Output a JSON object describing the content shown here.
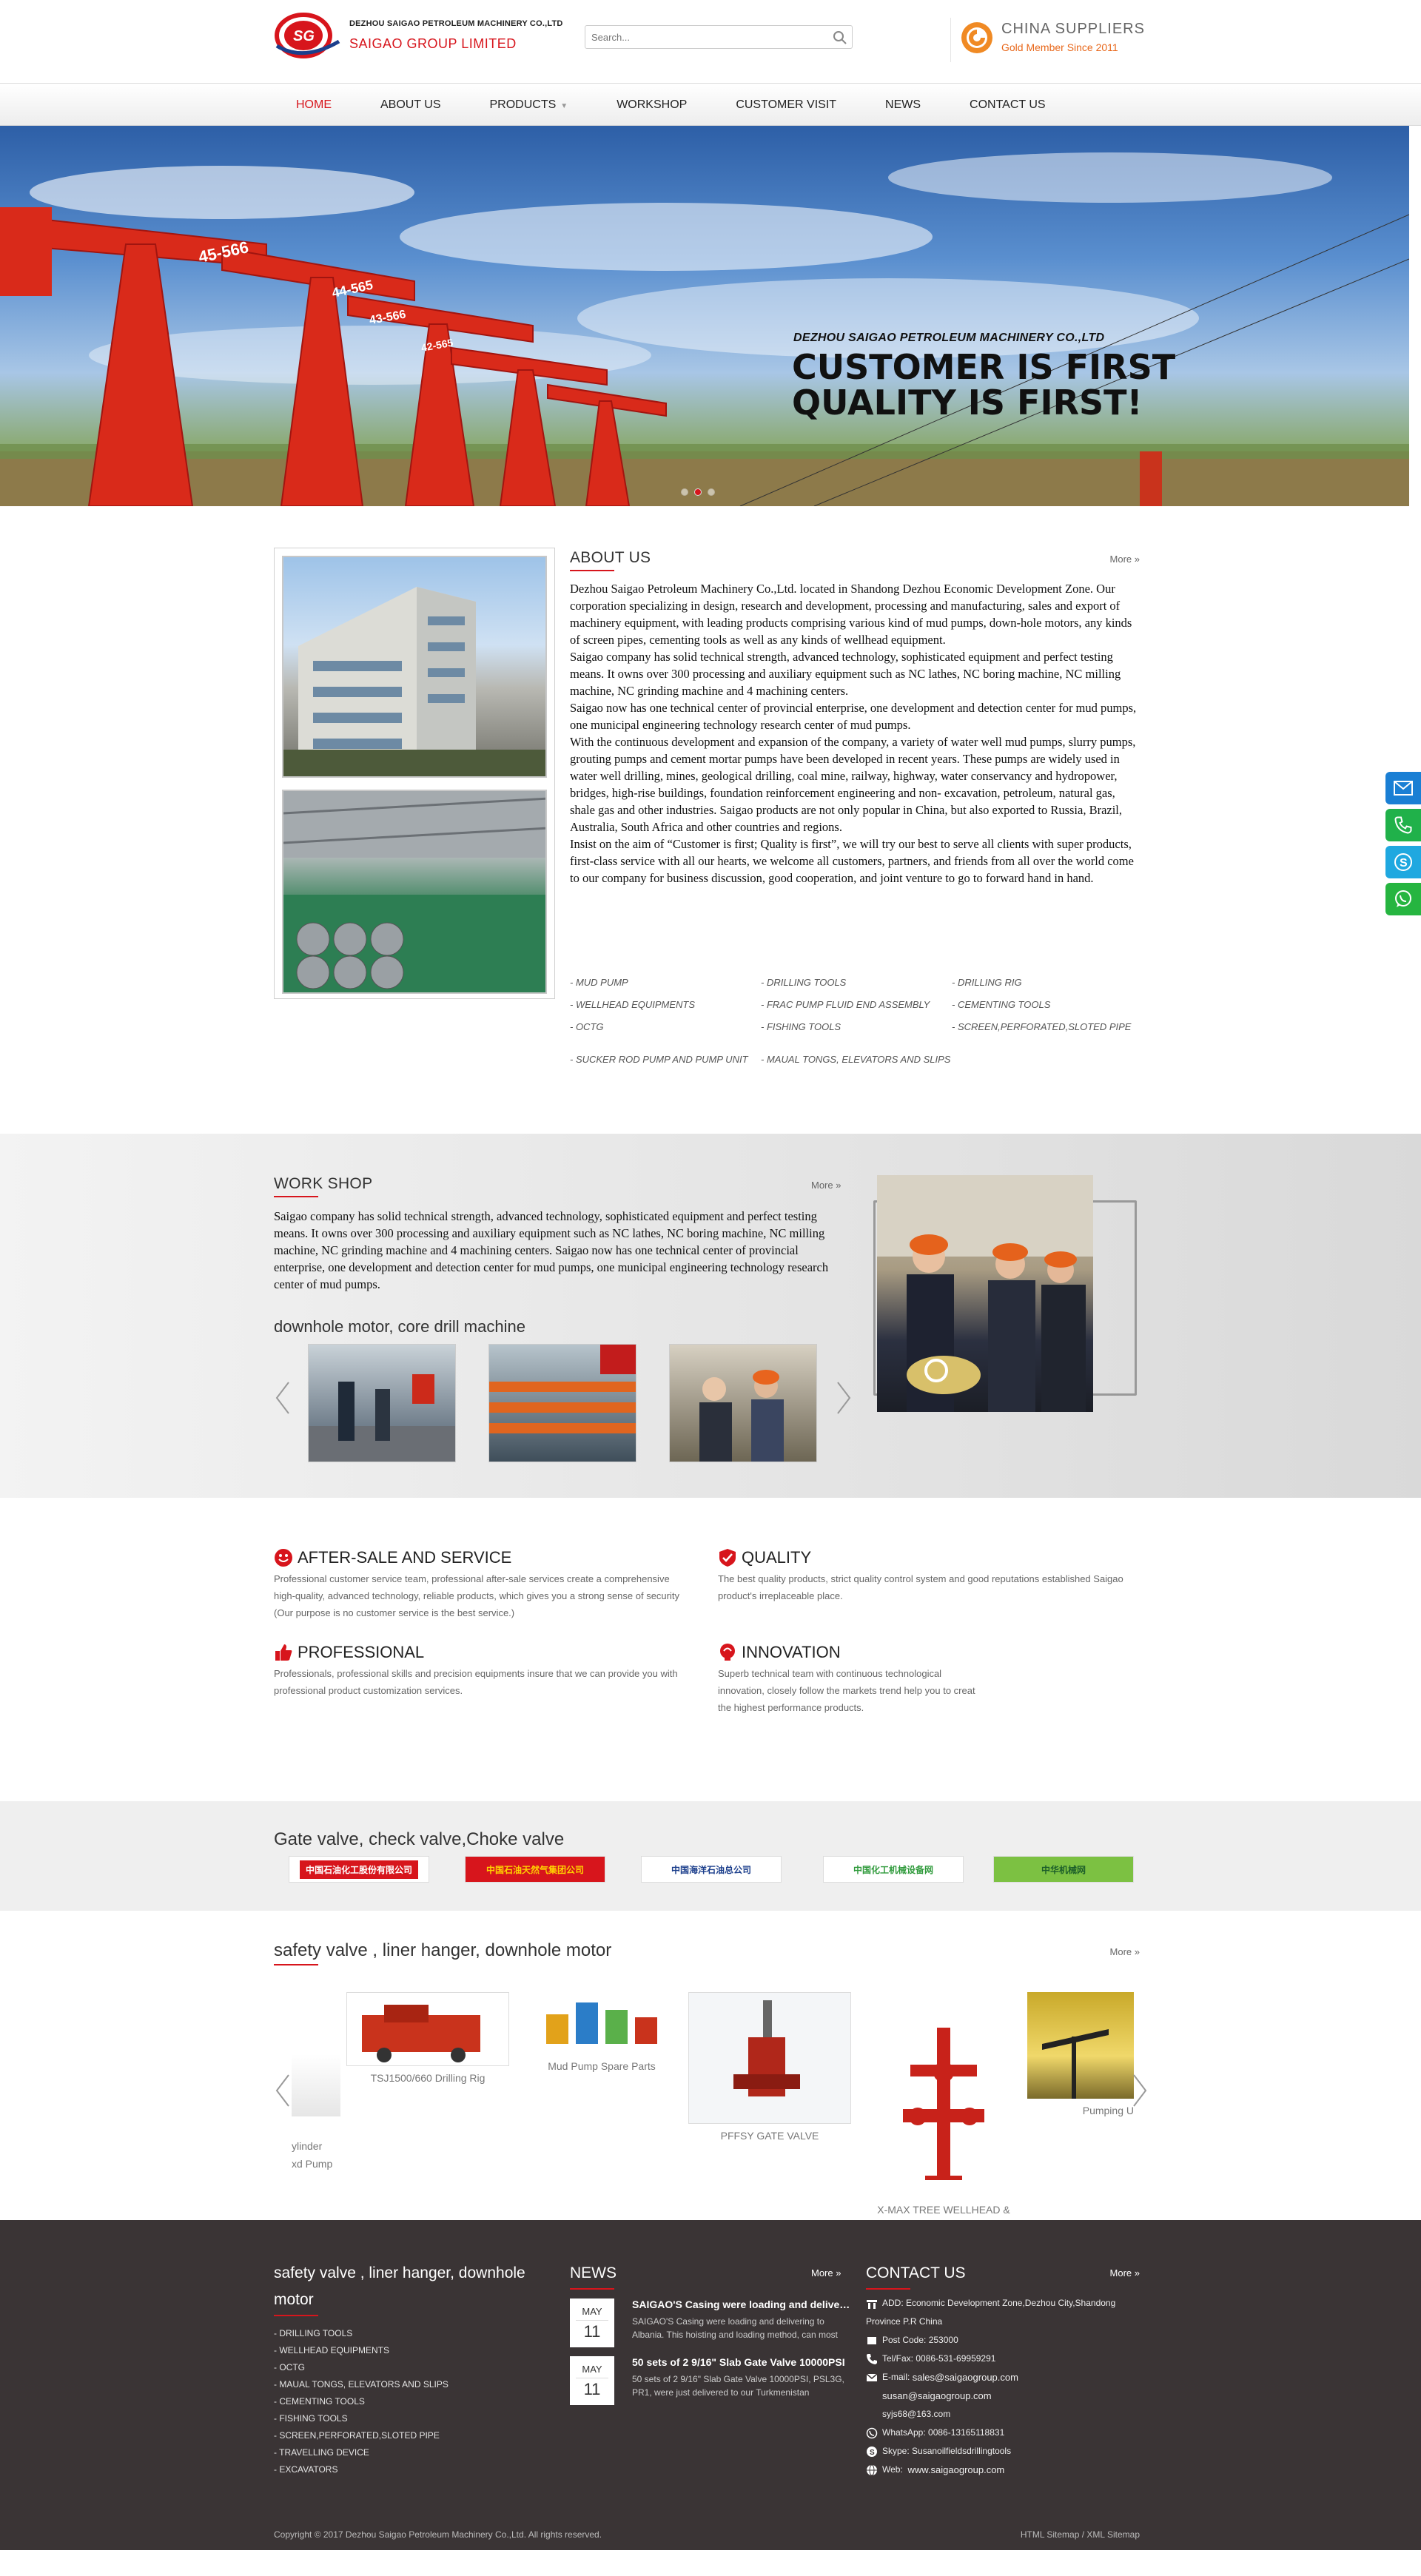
{
  "header": {
    "logo_line1": "DEZHOU SAIGAO PETROLEUM MACHINERY CO.,LTD",
    "logo_line2": "SAIGAO GROUP LIMITED",
    "logo_mark": "SG",
    "search_placeholder": "Search...",
    "supplier_title": "CHINA   SUPPLIERS",
    "supplier_sub": "Gold Member Since 2011"
  },
  "nav": {
    "items": [
      "HOME",
      "ABOUT US",
      "PRODUCTS",
      "WORKSHOP",
      "CUSTOMER VISIT",
      "NEWS",
      "CONTACT US"
    ],
    "active": "HOME"
  },
  "banner": {
    "company": "DEZHOU SAIGAO PETROLEUM MACHINERY CO.,LTD",
    "headline1": "CUSTOMER IS FIRST",
    "headline2": "QUALITY IS FIRST!",
    "pump_labels": [
      "45-566",
      "44-565",
      "43-566",
      "42-565"
    ],
    "slide_count": 3,
    "active_slide": 1
  },
  "about": {
    "title": "ABOUT US",
    "more": "More »",
    "paragraphs": [
      "Dezhou Saigao Petroleum Machinery Co.,Ltd. located in Shandong Dezhou Economic Development Zone. Our corporation specializing in design, research and development, processing and manufacturing, sales and export of machinery equipment, with leading products comprising various kind of mud pumps, down-hole motors, any kinds of screen pipes, cementing tools as well as any kinds of wellhead equipment.",
      "Saigao company has solid technical strength, advanced technology, sophisticated equipment and perfect testing means. It owns over 300 processing and auxiliary equipment such as NC lathes, NC boring machine, NC milling machine, NC grinding machine and 4 machining centers.",
      "Saigao now has one technical center of provincial enterprise, one development and detection center for mud pumps, one municipal engineering technology research center of mud pumps.",
      "With the continuous development and expansion of the company, a variety of water well mud pumps, slurry pumps, grouting pumps and cement mortar pumps have been developed in recent years. These pumps are widely used in water well drilling, mines, geological drilling, coal mine, railway, highway, water conservancy and hydropower, bridges, high-rise buildings, foundation reinforcement engineering and non- excavation, petroleum, natural gas, shale gas and other industries. Saigao products are not only popular in China, but also exported to Russia, Brazil, Australia, South Africa and other countries and regions.",
      "Insist on the aim of “Customer is first; Quality is first”, we will try our best to serve all clients with super products, first-class service with all our hearts, we welcome all customers, partners, and friends from all over the world come to our company for business discussion, good cooperation, and joint venture to go to forward hand in hand."
    ],
    "categories": [
      "- MUD PUMP",
      "- DRILLING TOOLS",
      "- DRILLING RIG",
      "- WELLHEAD EQUIPMENTS",
      "- FRAC PUMP FLUID END ASSEMBLY",
      "- CEMENTING TOOLS",
      "- OCTG",
      "- FISHING TOOLS",
      "- SCREEN,PERFORATED,SLOTED PIPE",
      "- SUCKER ROD PUMP AND PUMP UNIT",
      "- MAUAL TONGS, ELEVATORS AND SLIPS",
      ""
    ]
  },
  "workshop": {
    "title": "WORK SHOP",
    "more": "More »",
    "text": "Saigao company has solid technical strength, advanced technology, sophisticated equipment and perfect testing means. It owns over 300 processing and auxiliary equipment such as NC lathes, NC boring machine, NC milling machine, NC grinding machine and 4 machining centers. Saigao now has one technical center of provincial enterprise, one development and detection center for mud pumps, one municipal engineering technology research center of mud pumps.",
    "subtitle": "downhole motor, core drill machine"
  },
  "service": [
    {
      "title": "AFTER-SALE AND SERVICE",
      "icon": "smile-icon",
      "text": "Professional customer service team, professional after-sale services create a comprehensive high-quality, advanced technology, reliable products, which gives you a strong sense of security (Our purpose is no customer service is the best service.)"
    },
    {
      "title": "QUALITY",
      "icon": "shield-check-icon",
      "text": "The best quality products, strict quality control system and good reputations established Saigao product's irreplaceable place."
    },
    {
      "title": "PROFESSIONAL",
      "icon": "thumbs-up-icon",
      "text": "Professionals, professional skills and precision equipments insure that we can provide you with professional product customization services."
    },
    {
      "title": "INNOVATION",
      "icon": "lightbulb-icon",
      "text": "Superb technical team with continuous technological innovation, closely follow the markets trend help you to creat the highest performance products."
    }
  ],
  "partners": {
    "title": "Gate valve, check valve,Choke valve",
    "logos": [
      {
        "text": "中国石油化工股份有限公司",
        "color": "#d7151c",
        "bg": "#d7151c",
        "fg": "#ffffff"
      },
      {
        "text": "中国石油天然气集团公司",
        "color": "#d7151c",
        "bg": "#d7151c",
        "fg": "#ffd200"
      },
      {
        "text": "中国海洋石油总公司",
        "color": "#1c3f8c",
        "bg": "#ffffff",
        "fg": "#1c3f8c"
      },
      {
        "text": "中国化工机械设备网",
        "color": "#2f9a3b",
        "bg": "#ffffff",
        "fg": "#2f9a3b"
      },
      {
        "text": "中华机械网",
        "color": "#7cc142",
        "bg": "#7cc142",
        "fg": "#1c5e2a"
      }
    ]
  },
  "products": {
    "title": "safety valve , liner hanger, downhole motor",
    "more": "More »",
    "items": [
      {
        "label": "ylinder\nxd Pump"
      },
      {
        "label": "TSJ1500/660 Drilling Rig"
      },
      {
        "label": "Mud Pump Spare Parts"
      },
      {
        "label": "PFFSY GATE VALVE"
      },
      {
        "label": "X-MAX TREE WELLHEAD &\nCHRISTMAS TREE EQUIPMENT"
      },
      {
        "label": "Pumping U"
      }
    ]
  },
  "footer": {
    "col1_title": "safety valve , liner hanger, downhole motor",
    "col1_items": [
      "- DRILLING TOOLS",
      "- WELLHEAD EQUIPMENTS",
      "- OCTG",
      "- MAUAL TONGS, ELEVATORS AND SLIPS",
      "- CEMENTING TOOLS",
      "- FISHING TOOLS",
      "- SCREEN,PERFORATED,SLOTED PIPE",
      "- TRAVELLING DEVICE",
      "- EXCAVATORS"
    ],
    "news_title": "NEWS",
    "news_more": "More »",
    "news": [
      {
        "month": "MAY",
        "day": "11",
        "title": "SAIGAO'S Casing were loading and delivering to Albania.",
        "summary": "SAIGAO'S Casing were loading and delivering to Albania. This hoisting and loading method, can most"
      },
      {
        "month": "MAY",
        "day": "11",
        "title": "50 sets of 2 9/16\" Slab Gate Valve 10000PSI",
        "summary": "50 sets of 2 9/16\" Slab Gate Valve 10000PSI, PSL3G, PR1, were just delivered to our Turkmenistan"
      }
    ],
    "contact_title": "CONTACT US",
    "contact_more": "More »",
    "contact": {
      "add": "ADD: Economic Development Zone,Dezhou City,Shandong",
      "add2": "Province P.R China",
      "post": "Post Code: 253000",
      "tel": "Tel/Fax: 0086-531-69959291",
      "email_label": "E-mail:",
      "email1": "sales@saigaogroup.com",
      "email2": "susan@saigaogroup.com",
      "email3": "syjs68@163.com",
      "whatsapp": "WhatsApp: 0086-13165118831",
      "skype": "Skype: Susanoilfieldsdrillingtools",
      "web_label": "Web:",
      "web": "www.saigaogroup.com"
    },
    "copyright": "Copyright © 2017 Dezhou Saigao Petroleum Machinery Co.,Ltd.  All rights reserved.",
    "links": "HTML Sitemap / XML Sitemap"
  },
  "float_bar": [
    {
      "icon": "email-icon",
      "color": "#1a7fd4"
    },
    {
      "icon": "phone-icon",
      "color": "#20b14a"
    },
    {
      "icon": "skype-icon",
      "color": "#1fa8e0"
    },
    {
      "icon": "whatsapp-icon",
      "color": "#26b540"
    }
  ]
}
